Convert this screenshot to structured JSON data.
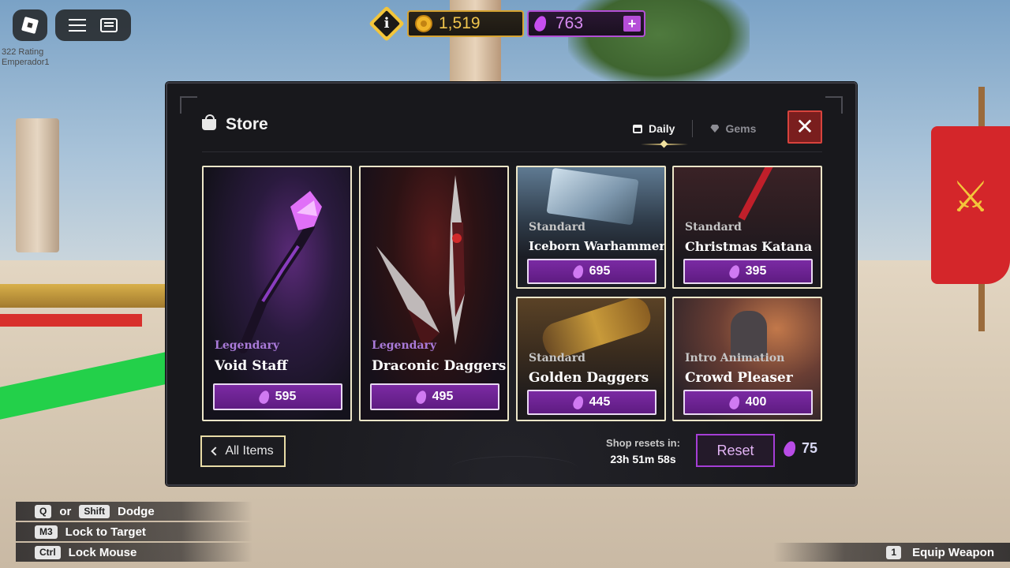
{
  "hud": {
    "rating_text": "322 Rating",
    "rating_player": "Emperador1",
    "coins": "1,519",
    "gems": "763",
    "plus_label": "+",
    "info_label": "i"
  },
  "store": {
    "title": "Store",
    "tabs": [
      {
        "label": "Daily",
        "active": true,
        "icon": "calendar-icon"
      },
      {
        "label": "Gems",
        "active": false,
        "icon": "gem-icon"
      }
    ],
    "close_label": "✕",
    "items": [
      {
        "rarity": "Legendary",
        "name": "Void Staff",
        "price": "595"
      },
      {
        "rarity": "Legendary",
        "name": "Draconic Daggers",
        "price": "495"
      },
      {
        "rarity": "Standard",
        "name": "Iceborn Warhammer",
        "price": "695"
      },
      {
        "rarity": "Standard",
        "name": "Christmas Katana",
        "price": "395"
      },
      {
        "rarity": "Standard",
        "name": "Golden Daggers",
        "price": "445"
      },
      {
        "rarity": "Intro Animation",
        "name": "Crowd Pleaser",
        "price": "400"
      }
    ],
    "all_items_label": "All Items",
    "reset_label": "Shop resets in:",
    "reset_timer": "23h 51m 58s",
    "reset_button": "Reset",
    "reset_cost": "75"
  },
  "hints": [
    {
      "keys": [
        "Q",
        "Shift"
      ],
      "joiner": "or",
      "action": "Dodge"
    },
    {
      "keys": [
        "M3"
      ],
      "action": "Lock to Target"
    },
    {
      "keys": [
        "Ctrl"
      ],
      "action": "Lock Mouse"
    }
  ],
  "equip_hint": {
    "key": "1",
    "action": "Equip Weapon"
  },
  "colors": {
    "coin": "#f0c54d",
    "gem": "#c84ef0",
    "legendary": "#a97ad8",
    "buy_button": "#6a2290",
    "close_button": "#d8433d"
  }
}
